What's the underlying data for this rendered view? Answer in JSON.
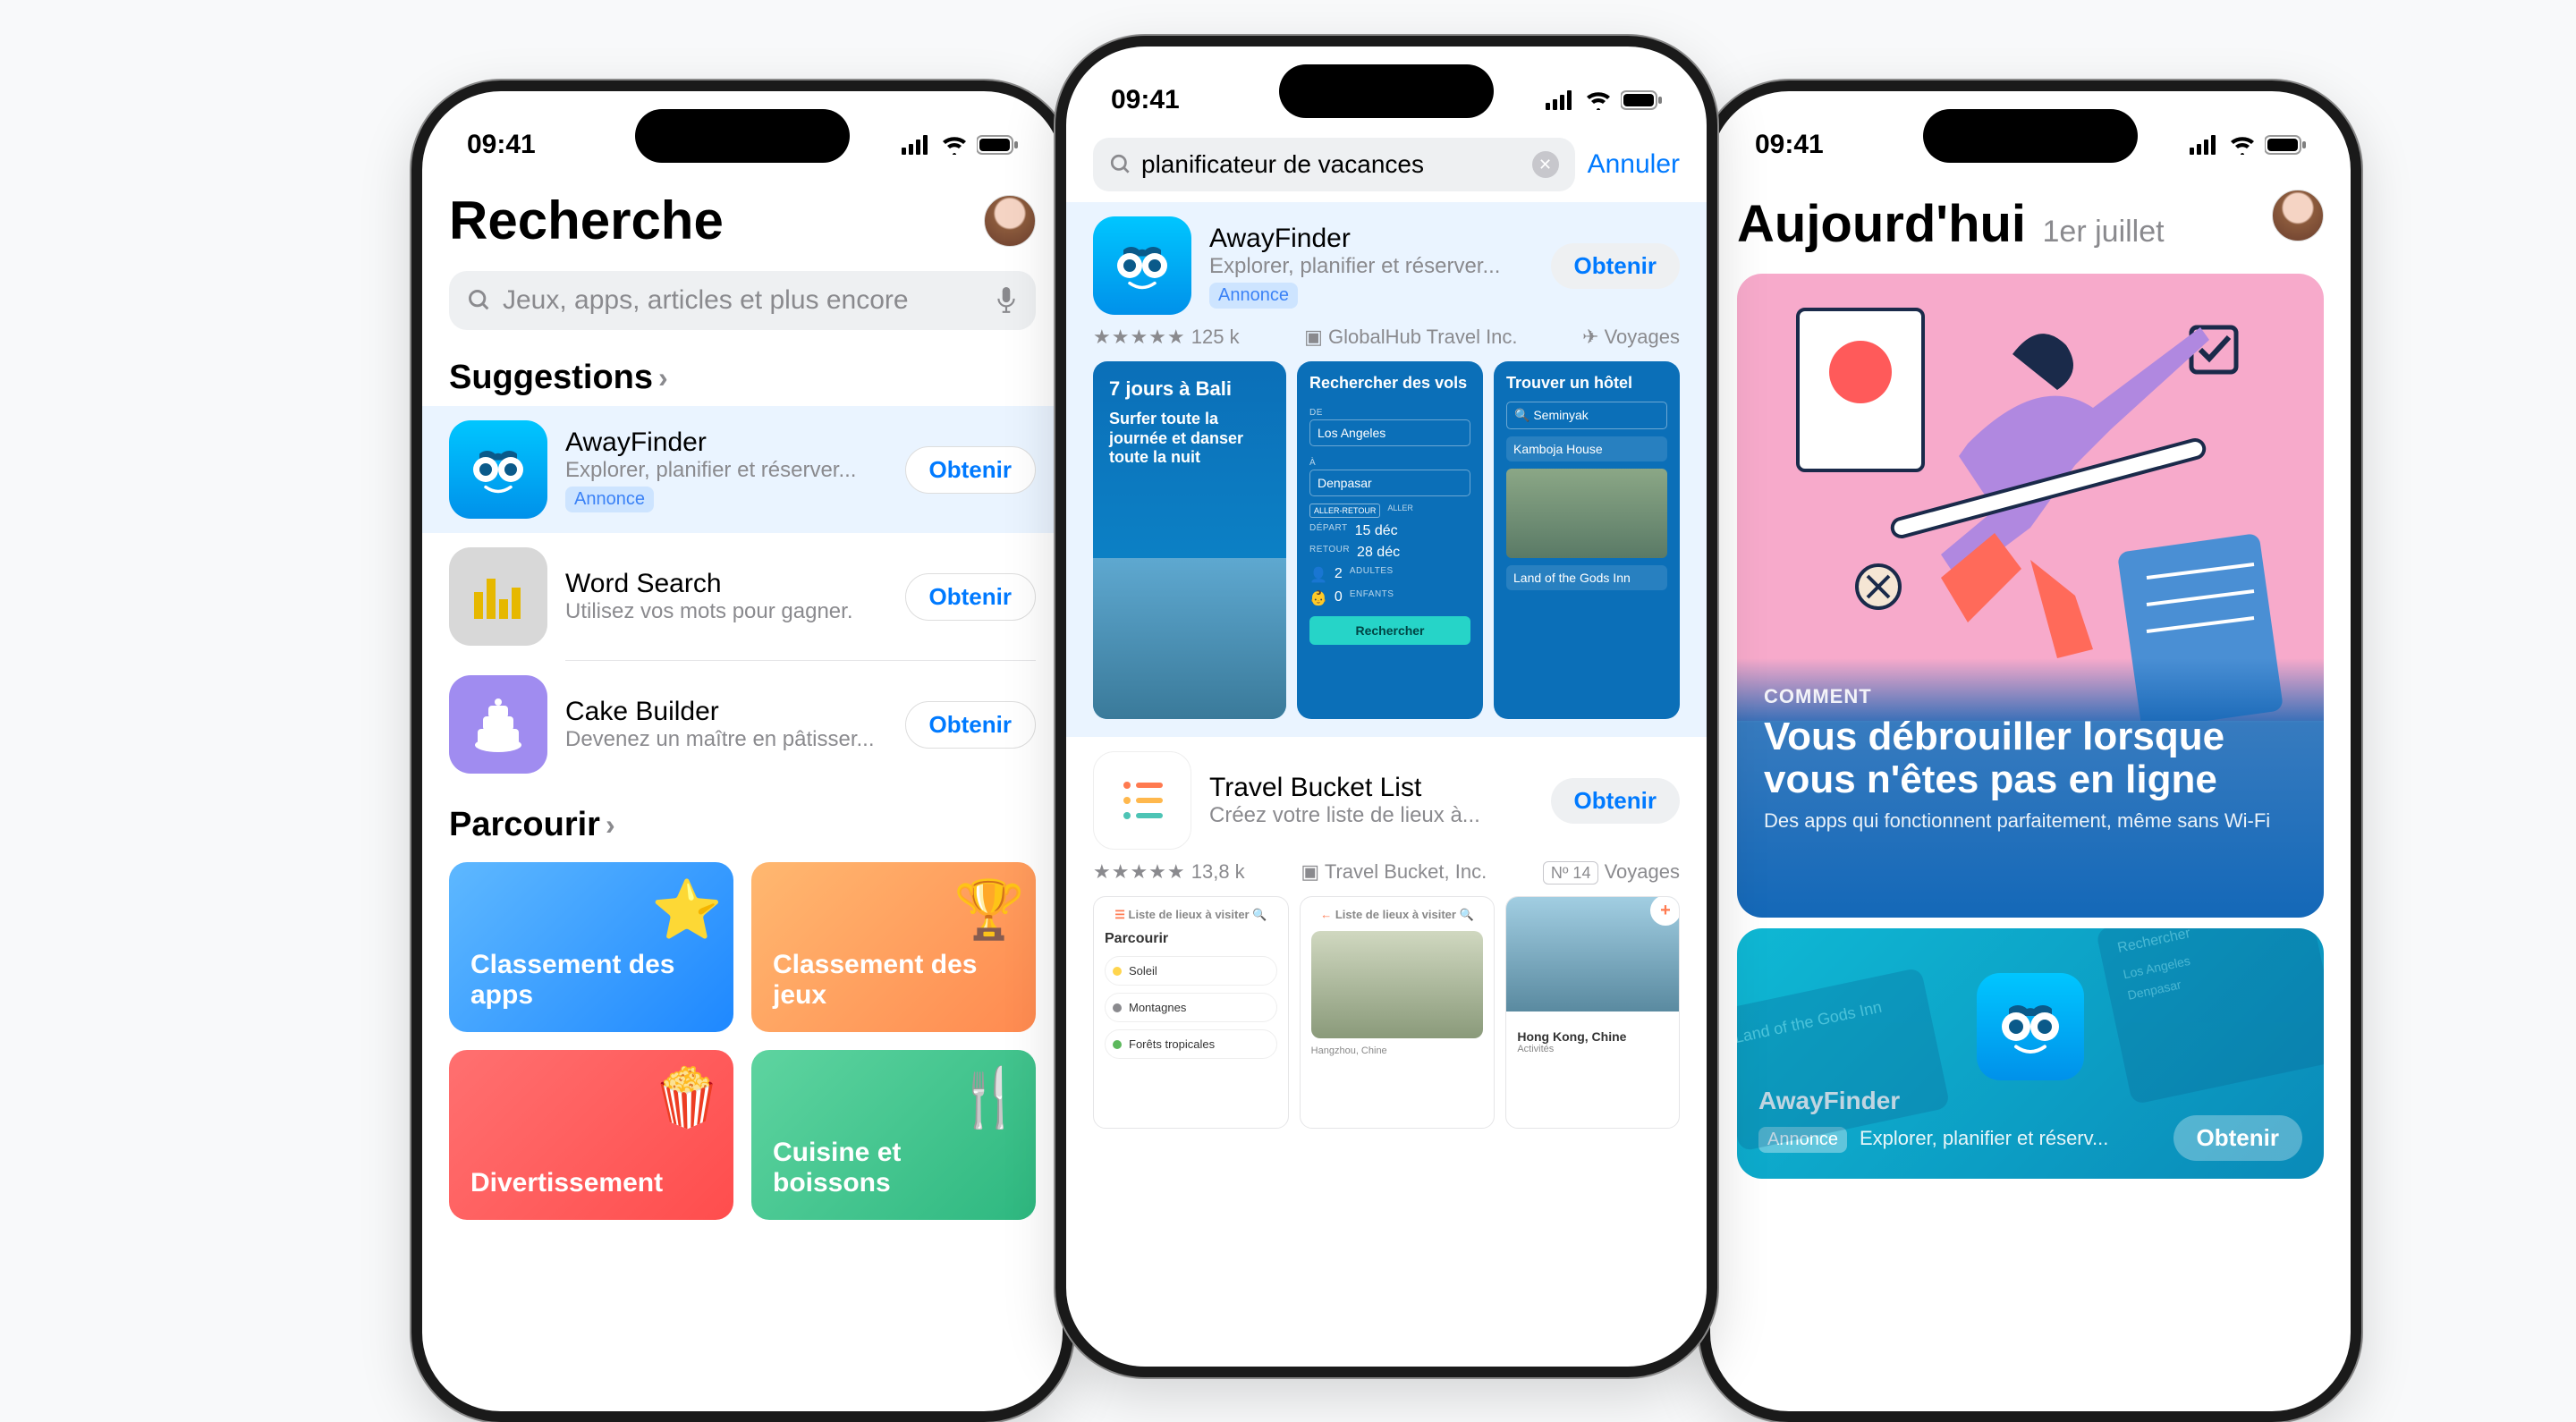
{
  "status": {
    "time": "09:41"
  },
  "left": {
    "title": "Recherche",
    "search_placeholder": "Jeux, apps, articles et plus encore",
    "sections": {
      "suggestions": "Suggestions",
      "browse": "Parcourir"
    },
    "suggestions": [
      {
        "name": "AwayFinder",
        "desc": "Explorer, planifier et réserver...",
        "ad": "Annonce",
        "cta": "Obtenir"
      },
      {
        "name": "Word Search",
        "desc": "Utilisez vos mots pour gagner.",
        "cta": "Obtenir"
      },
      {
        "name": "Cake Builder",
        "desc": "Devenez un maître en pâtisser...",
        "cta": "Obtenir"
      }
    ],
    "tiles": [
      {
        "label": "Classement des apps"
      },
      {
        "label": "Classement des jeux"
      },
      {
        "label": "Divertissement"
      },
      {
        "label": "Cuisine et boissons"
      }
    ]
  },
  "center": {
    "search_value": "planificateur de vacances",
    "cancel": "Annuler",
    "results": [
      {
        "name": "AwayFinder",
        "desc": "Explorer, planifier et réserver...",
        "ad": "Annonce",
        "cta": "Obtenir",
        "rating_count": "125 k",
        "developer": "GlobalHub Travel Inc.",
        "category": "Voyages",
        "previews": {
          "p1": {
            "title": "7 jours à Bali",
            "subtitle": "Surfer toute la journée et danser toute la nuit"
          },
          "p2": {
            "title": "Rechercher des vols",
            "from_label": "DE",
            "from": "Los Angeles",
            "to_label": "À",
            "to": "Denpasar",
            "roundtrip": "ALLER-RETOUR",
            "oneway": "ALLER",
            "depart_label": "DÉPART",
            "depart": "15 déc",
            "return_label": "RETOUR",
            "return": "28 déc",
            "adults": "2",
            "adults_label": "ADULTES",
            "kids": "0",
            "kids_label": "ENFANTS",
            "button": "Rechercher"
          },
          "p3": {
            "title": "Trouver un hôtel",
            "location": "Seminyak",
            "hotel1": "Kamboja House",
            "hotel2": "Land of the Gods Inn"
          }
        }
      },
      {
        "name": "Travel Bucket List",
        "desc": "Créez votre liste de lieux à...",
        "cta": "Obtenir",
        "rating_count": "13,8 k",
        "developer": "Travel Bucket, Inc.",
        "rank": "Nº 14",
        "category": "Voyages",
        "previews": {
          "rp1": {
            "header": "Liste de lieux à visiter",
            "section": "Parcourir",
            "chips": [
              "Soleil",
              "Montagnes",
              "Forêts tropicales"
            ]
          },
          "rp2": {
            "header": "Liste de lieux à visiter",
            "caption": "Hangzhou, Chine"
          },
          "rp3": {
            "caption": "Hong Kong, Chine",
            "sub": "Activités"
          }
        }
      }
    ]
  },
  "right": {
    "title": "Aujourd'hui",
    "date": "1er juillet",
    "story": {
      "eyebrow": "COMMENT",
      "title": "Vous débrouiller lorsque vous n'êtes pas en ligne",
      "subtitle": "Des apps qui fonctionnent parfaitement, même sans Wi-Fi"
    },
    "promo": {
      "name": "AwayFinder",
      "ad": "Annonce",
      "desc": "Explorer, planifier et réserv...",
      "cta": "Obtenir",
      "bg_labels": {
        "hotel": "Land of the Gods Inn",
        "search": "Rechercher",
        "from": "Los Angeles",
        "to": "Denpasar"
      }
    }
  }
}
